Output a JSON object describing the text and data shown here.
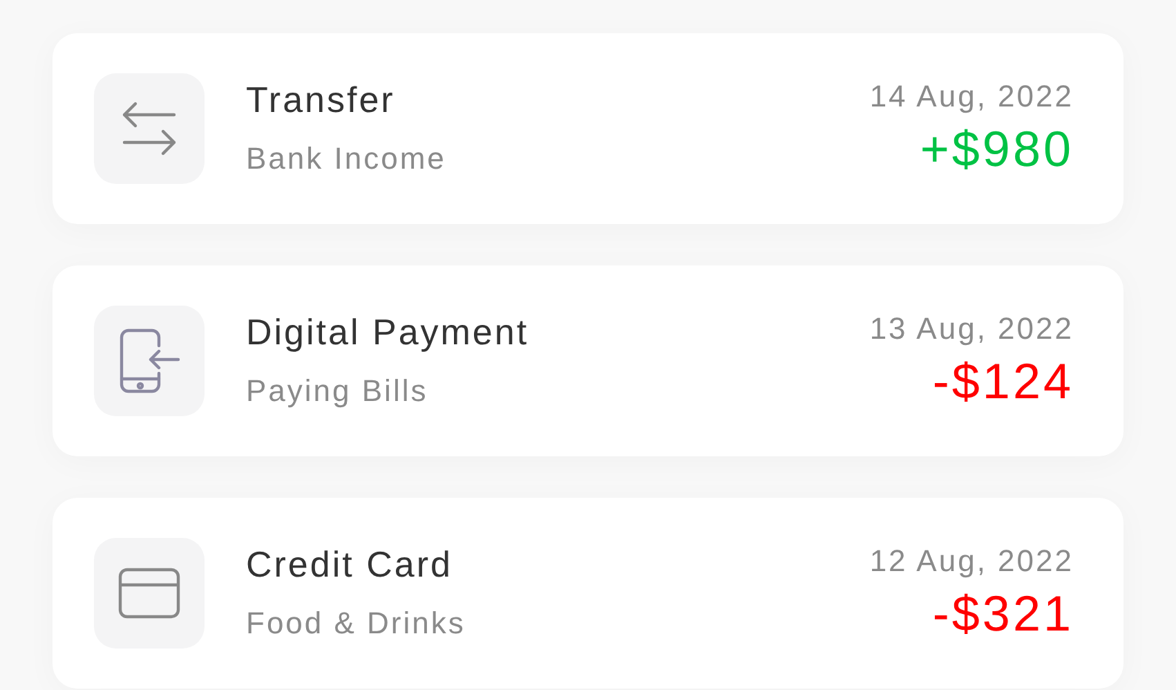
{
  "transactions": [
    {
      "kind": "transfer",
      "title": "Transfer",
      "subtitle": "Bank Income",
      "date": "14 Aug, 2022",
      "amount": "+$980",
      "color": "#00c244"
    },
    {
      "kind": "phone",
      "title": "Digital Payment",
      "subtitle": "Paying Bills",
      "date": "13 Aug, 2022",
      "amount": "-$124",
      "color": "#ff0000"
    },
    {
      "kind": "card",
      "title": "Credit Card",
      "subtitle": "Food & Drinks",
      "date": "12 Aug, 2022",
      "amount": "-$321",
      "color": "#ff0000"
    }
  ]
}
